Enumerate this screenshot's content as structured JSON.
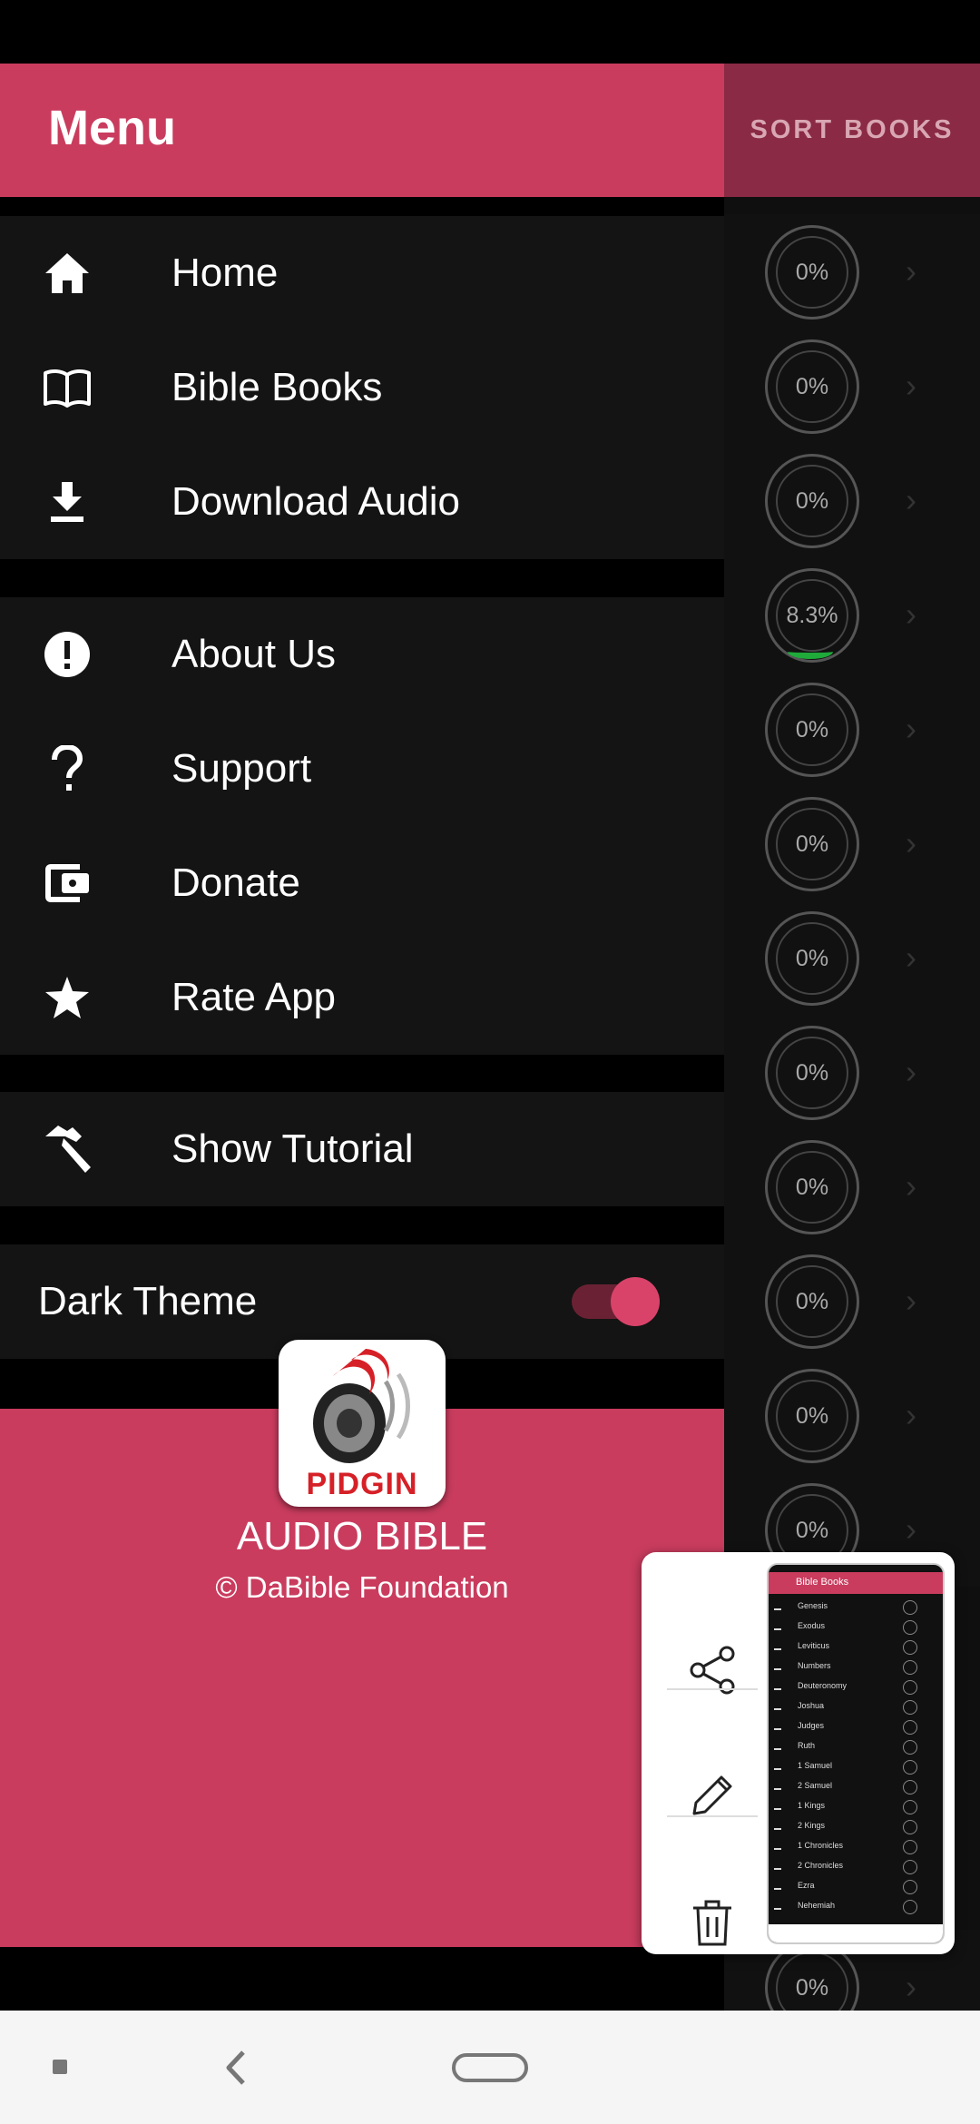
{
  "app_bar": {
    "title": "Menu",
    "sort_books_label": "SORT BOOKS"
  },
  "book_progress": [
    "0%",
    "0%",
    "0%",
    "8.3%",
    "0%",
    "0%",
    "0%",
    "0%",
    "0%",
    "0%",
    "0%",
    "0%",
    "0%"
  ],
  "last_progress": "0%",
  "menu_groups": [
    {
      "items": [
        {
          "label": "Home",
          "icon": "home-icon"
        },
        {
          "label": "Bible Books",
          "icon": "book-open-icon"
        },
        {
          "label": "Download Audio",
          "icon": "download-icon"
        }
      ]
    },
    {
      "items": [
        {
          "label": "About Us",
          "icon": "info-exclamation-icon"
        },
        {
          "label": "Support",
          "icon": "question-icon"
        },
        {
          "label": "Donate",
          "icon": "wallet-icon"
        },
        {
          "label": "Rate App",
          "icon": "star-icon"
        }
      ]
    },
    {
      "items": [
        {
          "label": "Show Tutorial",
          "icon": "hammer-icon"
        }
      ]
    }
  ],
  "dark_theme": {
    "label": "Dark Theme",
    "enabled": true
  },
  "footer": {
    "logo_text": "PIDGIN",
    "app_name": "AUDIO BIBLE",
    "copyright": "© DaBible Foundation"
  },
  "screenshot_popup": {
    "actions": [
      "share-icon",
      "edit-icon",
      "delete-icon"
    ],
    "thumb_title": "Bible Books",
    "thumb_books": [
      "Genesis",
      "Exodus",
      "Leviticus",
      "Numbers",
      "Deuteronomy",
      "Joshua",
      "Judges",
      "Ruth",
      "1 Samuel",
      "2 Samuel",
      "1 Kings",
      "2 Kings",
      "1 Chronicles",
      "2 Chronicles",
      "Ezra",
      "Nehemiah"
    ]
  },
  "colors": {
    "accent": "#c93c5e",
    "drawer_bg": "#141414",
    "toggle_on": "#d9436a",
    "progress_green": "#1faa3a"
  }
}
